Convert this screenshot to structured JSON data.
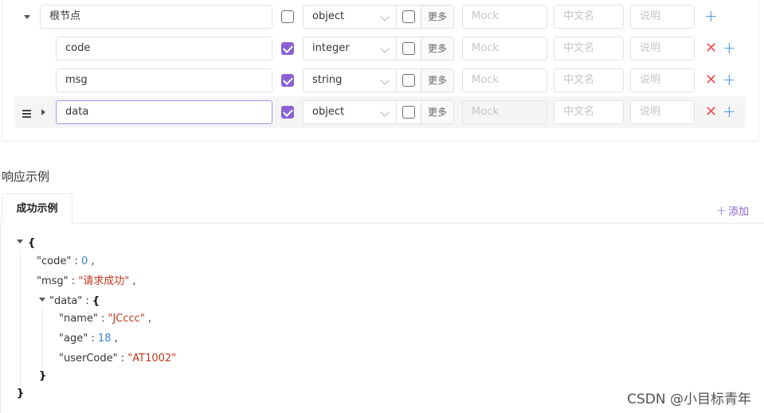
{
  "schema": {
    "root": {
      "name": "根节点",
      "type": "object",
      "required": false,
      "more": "更多",
      "mock_placeholder": "Mock",
      "title_placeholder": "中文名",
      "desc_placeholder": "说明"
    },
    "children": [
      {
        "name": "code",
        "type": "integer",
        "required": true,
        "more": "更多",
        "mock_placeholder": "Mock",
        "title_placeholder": "中文名",
        "desc_placeholder": "说明"
      },
      {
        "name": "msg",
        "type": "string",
        "required": true,
        "more": "更多",
        "mock_placeholder": "Mock",
        "title_placeholder": "中文名",
        "desc_placeholder": "说明"
      },
      {
        "name": "data",
        "type": "object",
        "required": true,
        "more": "更多",
        "mock_placeholder": "Mock",
        "title_placeholder": "中文名",
        "desc_placeholder": "说明"
      }
    ]
  },
  "response": {
    "section_title": "响应示例",
    "tabs": [
      {
        "label": "成功示例"
      }
    ],
    "add_label": "添加",
    "json": {
      "open": "{",
      "close": "}",
      "code_key": "\"code\"",
      "code_val": "0",
      "msg_key": "\"msg\"",
      "msg_val": "\"请求成功\"",
      "data_key": "\"data\"",
      "data_open": "{",
      "data_close": "}",
      "name_key": "\"name\"",
      "name_val": "\"JCccc\"",
      "age_key": "\"age\"",
      "age_val": "18",
      "usercode_key": "\"userCode\"",
      "usercode_val": "\"AT1002\""
    }
  },
  "watermark": "CSDN @小目标青年",
  "colors": {
    "accent": "#8a63d2",
    "plus": "#3b8fe0",
    "remove": "#ee4b58",
    "number": "#3a84d2",
    "string": "#c2361c"
  },
  "icons": [
    "caret-down-icon",
    "caret-right-icon",
    "drag-handle-icon",
    "chevron-down-icon",
    "plus-icon",
    "close-icon"
  ]
}
